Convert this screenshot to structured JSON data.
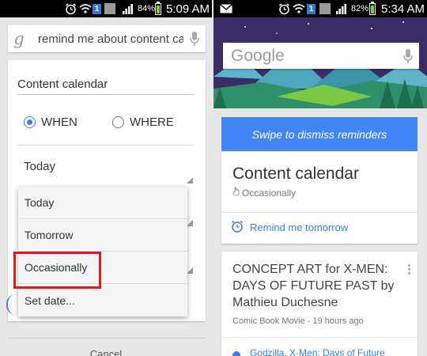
{
  "left": {
    "status": {
      "battery": "84%",
      "time": "5:09 AM",
      "notif_count": "1"
    },
    "search": {
      "query": "remind me about content ca"
    },
    "form": {
      "title_value": "Content calendar",
      "when_label": "WHEN",
      "where_label": "WHERE",
      "date_value": "Today"
    },
    "dropdown": {
      "options": [
        "Today",
        "Tomorrow",
        "Occasionally",
        "Set date..."
      ]
    },
    "cancel_label": "Cancel"
  },
  "right": {
    "status": {
      "battery": "82%",
      "time": "5:34 AM",
      "notif_count": "1"
    },
    "search": {
      "logo": "Google"
    },
    "swipe_banner": "Swipe to dismiss reminders",
    "reminder_card": {
      "title": "Content calendar",
      "frequency": "Occasionally",
      "action": "Remind me tomorrow"
    },
    "news_card": {
      "title": "CONCEPT ART for X-MEN: DAYS OF FUTURE PAST by Mathieu Duchesne",
      "source": "Comic Book Movie - 19 hours ago",
      "related_link": "Godzilla, X-Men: Days of Future"
    }
  },
  "colors": {
    "accent_blue": "#4285f4",
    "link_blue": "#3b7ee5",
    "highlight_red": "#e0191b",
    "banner_purple": "#3a2d66"
  },
  "icons": [
    "google-g-icon",
    "mic-icon",
    "alarm-icon",
    "wifi-icon",
    "signal-icon",
    "battery-icon",
    "mail-icon",
    "hand-icon",
    "menu-dots-icon"
  ]
}
